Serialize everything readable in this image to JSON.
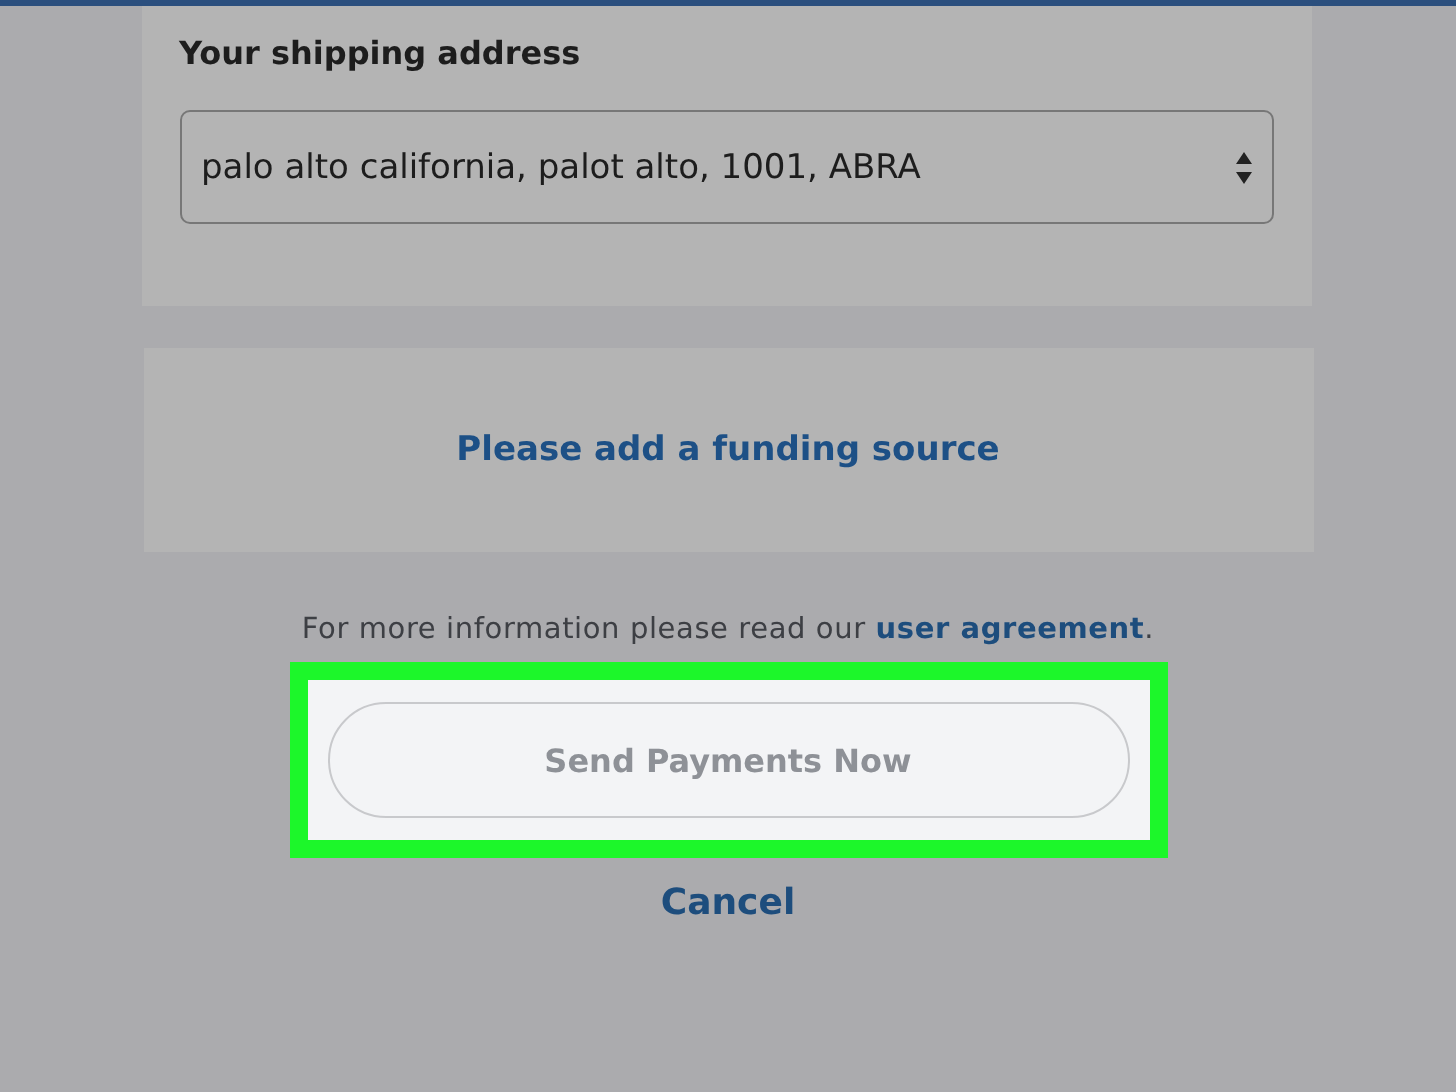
{
  "shipping": {
    "label": "Your shipping address",
    "value": "palo alto california, palot alto, 1001, ABRA"
  },
  "funding_prompt": "Please add a funding source",
  "info": {
    "text_before": "For more information please read our ",
    "link": "user agreement",
    "text_after": "."
  },
  "send_button": {
    "label": "Send Payments Now",
    "disabled": true,
    "highlighted": true
  },
  "cancel": "Cancel"
}
